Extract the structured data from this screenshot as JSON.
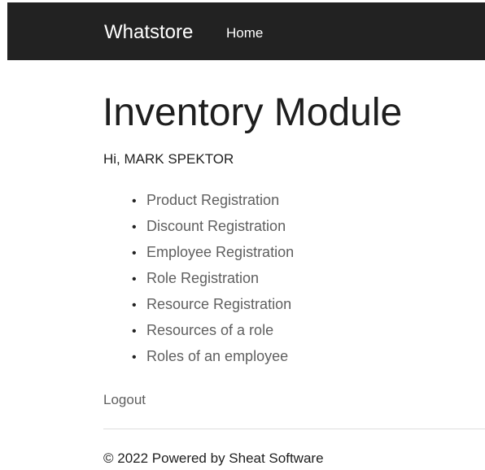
{
  "navbar": {
    "brand": "Whatstore",
    "links": [
      {
        "label": "Home"
      }
    ]
  },
  "main": {
    "title": "Inventory Module",
    "greeting": "Hi, MARK SPEKTOR",
    "menu": [
      {
        "label": "Product Registration"
      },
      {
        "label": "Discount Registration"
      },
      {
        "label": "Employee Registration"
      },
      {
        "label": "Role Registration"
      },
      {
        "label": "Resource Registration"
      },
      {
        "label": "Resources of a role"
      },
      {
        "label": "Roles of an employee"
      }
    ],
    "logout_label": "Logout"
  },
  "footer": {
    "text": "© 2022 Powered by Sheat Software"
  },
  "colors": {
    "navbar_bg": "#222222",
    "link": "#5f5f5f",
    "text": "#1e1e1e",
    "divider": "#dddddd"
  }
}
